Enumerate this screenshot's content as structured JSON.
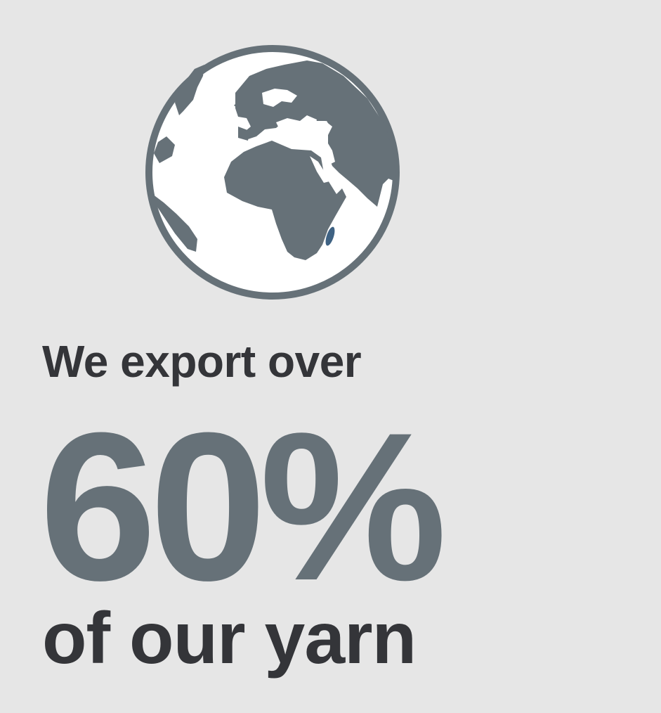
{
  "colors": {
    "background": "#e6e6e6",
    "icon": "#667178",
    "dark_text": "#343539",
    "accent_text": "#667178",
    "island": "#3f6283"
  },
  "icon": "globe-icon",
  "headline": {
    "lead": "We export over",
    "figure": "60%",
    "tail": "of our yarn"
  }
}
